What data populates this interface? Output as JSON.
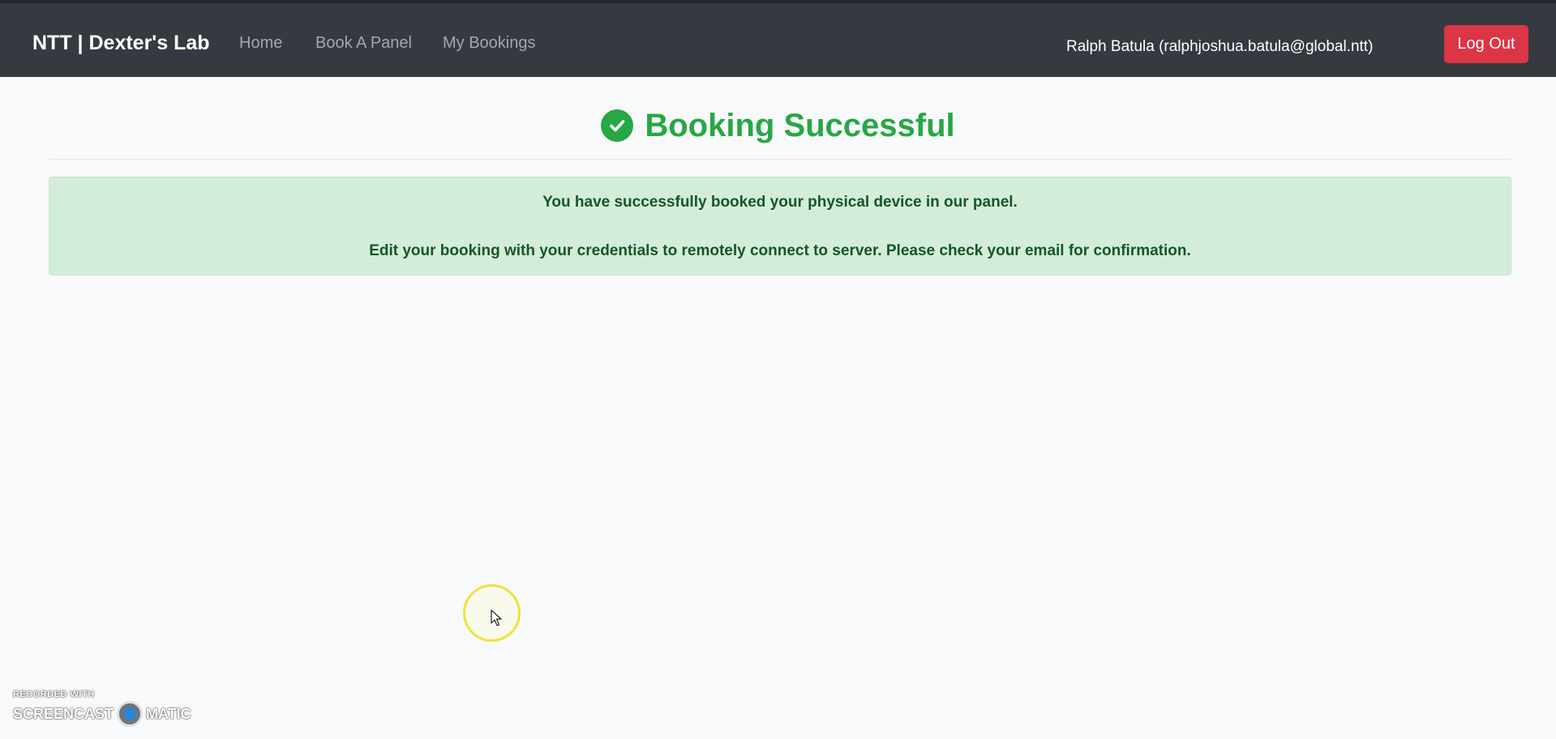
{
  "navbar": {
    "brand": "NTT | Dexter's Lab",
    "links": [
      "Home",
      "Book A Panel",
      "My Bookings"
    ],
    "user": "Ralph Batula (ralphjoshua.batula@global.ntt)",
    "logout_label": "Log Out"
  },
  "main": {
    "title": "Booking Successful",
    "title_icon": "check-circle-icon",
    "alert": {
      "line1": "You have successfully booked your physical device in our panel.",
      "line2": "Edit your booking with your credentials to remotely connect to server. Please check your email for confirmation."
    }
  },
  "watermark": {
    "top": "RECORDED WITH",
    "left": "SCREENCAST",
    "right": "MATIC"
  },
  "colors": {
    "navbar": "#343a40",
    "success": "#28a745",
    "alert_bg": "#d4edda",
    "alert_text": "#155724",
    "danger": "#dc3545"
  }
}
